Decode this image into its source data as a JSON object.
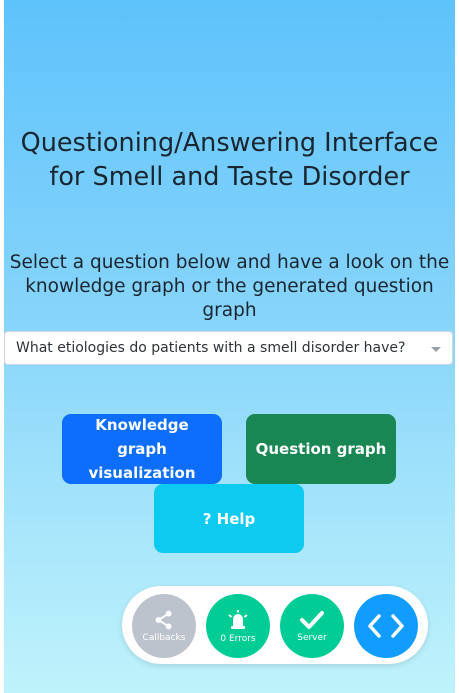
{
  "header": {
    "title": "Questioning/Answering Interface for Smell and Taste Disorder",
    "subtitle": "Select a question below and have a look on the knowledge graph or the generated question graph"
  },
  "question_select": {
    "value": "What etiologies do patients with a smell disorder have?"
  },
  "buttons": {
    "knowledge_graph": "Knowledge graph visualization",
    "question_graph": "Question graph",
    "help": "? Help"
  },
  "devtools": {
    "callbacks_label": "Callbacks",
    "errors_label": "0 Errors",
    "server_label": "Server"
  },
  "colors": {
    "primary": "#0d6efd",
    "success": "#198754",
    "info": "#0dcaf0",
    "devtools_green": "#00cc96",
    "devtools_blue": "#119dff",
    "devtools_grey": "#bdc3cc"
  },
  "icons": {
    "callbacks": "share-icon",
    "errors": "bell-icon",
    "server": "check-icon",
    "toggle": "code-brackets-icon",
    "select": "caret-down-icon"
  }
}
